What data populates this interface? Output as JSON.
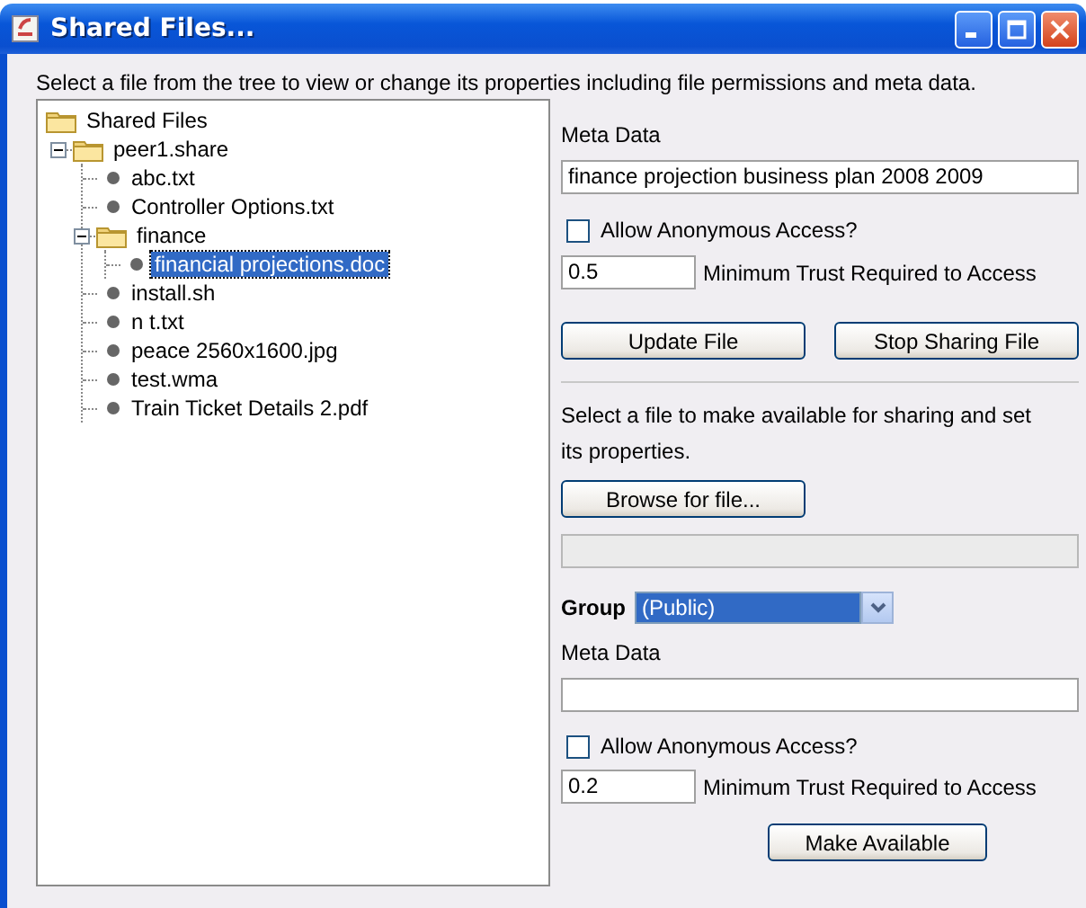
{
  "window": {
    "title": "Shared Files..."
  },
  "instruction": "Select a file from the tree to view or change its properties including file permissions and meta data.",
  "tree": [
    {
      "kind": "folder",
      "label": "Shared Files",
      "selected": false,
      "children": [
        {
          "kind": "folder",
          "label": "peer1.share",
          "expanded": true,
          "selected": false,
          "children": [
            {
              "kind": "file",
              "label": "abc.txt",
              "selected": false
            },
            {
              "kind": "file",
              "label": "Controller Options.txt",
              "selected": false
            },
            {
              "kind": "folder",
              "label": "finance",
              "expanded": true,
              "selected": false,
              "children": [
                {
                  "kind": "file",
                  "label": "financial projections.doc",
                  "selected": true
                }
              ]
            },
            {
              "kind": "file",
              "label": "install.sh",
              "selected": false
            },
            {
              "kind": "file",
              "label": "n t.txt",
              "selected": false
            },
            {
              "kind": "file",
              "label": "peace 2560x1600.jpg",
              "selected": false
            },
            {
              "kind": "file",
              "label": "test.wma",
              "selected": false
            },
            {
              "kind": "file",
              "label": "Train Ticket Details 2.pdf",
              "selected": false
            }
          ]
        }
      ]
    }
  ],
  "file_properties": {
    "meta_data_label": "Meta Data",
    "meta_data_value": "finance projection business plan 2008 2009",
    "anonymous": {
      "label": "Allow Anonymous Access?",
      "checked": false
    },
    "trust": {
      "value": "0.5",
      "label": "Minimum Trust Required to Access"
    },
    "buttons": [
      "Update File",
      "Stop Sharing File"
    ]
  },
  "share": {
    "instruction": "Select a file to make available for sharing and set its properties.",
    "browse_button": "Browse for file...",
    "group": {
      "label": "Group",
      "value": "(Public)"
    },
    "meta_data_label": "Meta Data",
    "anonymous": {
      "label": "Allow Anonymous Access?",
      "checked": false
    },
    "trust": {
      "value": "0.2",
      "label": "Minimum Trust Required to Access"
    },
    "button": "Make Available"
  }
}
